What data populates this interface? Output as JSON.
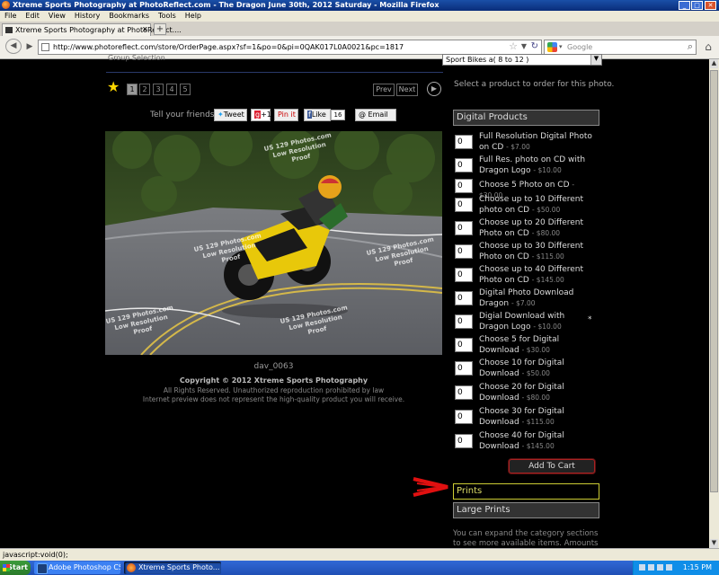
{
  "window": {
    "title": "Xtreme Sports Photography at PhotoReflect.com - The Dragon June 30th, 2012 Saturday - Mozilla Firefox",
    "min": "_",
    "max": "□",
    "close": "✕"
  },
  "menu": [
    "File",
    "Edit",
    "View",
    "History",
    "Bookmarks",
    "Tools",
    "Help"
  ],
  "tab": {
    "label": "Xtreme Sports Photography at PhotoReflect....",
    "close": "x",
    "new": "+"
  },
  "nav": {
    "back": "◀",
    "url": "http://www.photoreflect.com/store/OrderPage.aspx?sf=1&po=0&pi=0QAK017L0A0021&pc=1817",
    "search_engine_placeholder": "Google"
  },
  "page": {
    "group_selection": "Group Selection",
    "category_value": "Sport Bikes a( 8 to 12 )",
    "pages": [
      "1",
      "2",
      "3",
      "4",
      "5"
    ],
    "prev": "Prev",
    "next": "Next",
    "select_message": "Select a product to order for this photo.",
    "tell_friends": "Tell your friends",
    "share": {
      "tweet": "Tweet",
      "gplus": "+1",
      "pinit": "Pin it",
      "like": "Like",
      "like_count": "16",
      "email": "Email"
    },
    "watermark": [
      "US 129 Photos.com",
      "Low Resolution",
      "Proof"
    ],
    "photo_caption": "dav_0063",
    "copyright": "Copyright © 2012 Xtreme Sports Photography",
    "rights1": "All Rights Reserved. Unauthorized reproduction prohibited by law",
    "rights2": "Internet preview does not represent the high-quality product you will receive."
  },
  "sections": {
    "digital": "Digital Products",
    "prints": "Prints",
    "large_prints": "Large Prints"
  },
  "products": [
    {
      "qty": "0",
      "name": "Full Resolution Digital Photo on CD",
      "price": "- $7.00"
    },
    {
      "qty": "0",
      "name": "Full Res. photo on CD with Dragon Logo",
      "price": "- $10.00"
    },
    {
      "qty": "0",
      "name": "Choose 5 Photo on CD",
      "price": "- $30.00"
    },
    {
      "qty": "0",
      "name": "Choose up to 10 Different photo on CD",
      "price": "- $50.00"
    },
    {
      "qty": "0",
      "name": "Choose up to 20 Different Photo on CD",
      "price": "- $80.00"
    },
    {
      "qty": "0",
      "name": "Choose up to 30 Different Photo on CD",
      "price": "- $115.00"
    },
    {
      "qty": "0",
      "name": "Choose up to 40 Different Photo on CD",
      "price": "- $145.00"
    },
    {
      "qty": "0",
      "name": "Digital Photo Download Dragon",
      "price": "- $7.00"
    },
    {
      "qty": "0",
      "name": "Digial Download with Dragon Logo",
      "price": "- $10.00",
      "mark": "*"
    },
    {
      "qty": "0",
      "name": "Choose 5 for Digital Download",
      "price": "- $30.00"
    },
    {
      "qty": "0",
      "name": "Choose 10 for Digital Download",
      "price": "- $50.00"
    },
    {
      "qty": "0",
      "name": "Choose 20 for Digital Download",
      "price": "- $80.00"
    },
    {
      "qty": "0",
      "name": "Choose 30 for Digital Download",
      "price": "- $115.00"
    },
    {
      "qty": "0",
      "name": "Choose 40 for Digital Download",
      "price": "- $145.00"
    }
  ],
  "add_to_cart": "Add To Cart",
  "expand_text": "You can expand the category sections to see more available items. Amounts",
  "status": "javascript:void(0);",
  "taskbar": {
    "start": "Start",
    "tasks": [
      "Adobe Photoshop CS5.1 ...",
      "Xtreme Sports Photo..."
    ],
    "clock": "1:15 PM"
  },
  "colors": {
    "highlight_border": "#cccc33",
    "arrow": "#e01010",
    "star": "#ffd700"
  }
}
